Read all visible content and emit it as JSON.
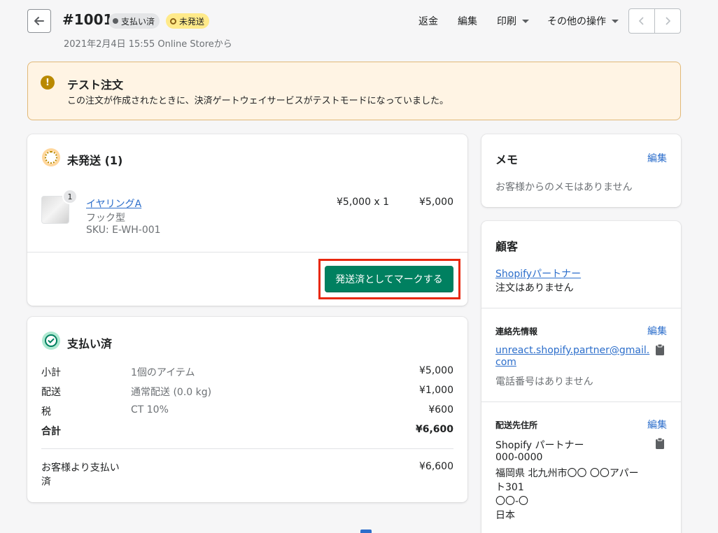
{
  "header": {
    "order_number": "#1001",
    "badge_paid": "支払い済",
    "badge_unfulfilled": "未発送",
    "subline": "2021年2月4日 15:55 Online Storeから",
    "actions": [
      "返金",
      "編集",
      "印刷",
      "その他の操作"
    ]
  },
  "banner": {
    "icon": "exclamation-icon",
    "title": "テスト注文",
    "text": "この注文が作成されたときに、決済ゲートウェイサービスがテストモードになっていました。"
  },
  "unfulfilled": {
    "title": "未発送 (1)",
    "item": {
      "quantity_badge": "1",
      "name": "イヤリングA",
      "variant": "フック型",
      "sku": "SKU: E-WH-001",
      "unit_price": "¥5,000 x 1",
      "total": "¥5,000"
    },
    "button": "発送済としてマークする"
  },
  "payment": {
    "title": "支払い済",
    "rows": [
      {
        "label": "小計",
        "detail": "1個のアイテム",
        "amount": "¥5,000"
      },
      {
        "label": "配送",
        "detail": "通常配送 (0.0 kg)",
        "amount": "¥1,000"
      },
      {
        "label": "税",
        "detail": "CT 10%",
        "amount": "¥600"
      },
      {
        "label": "合計",
        "detail": "",
        "amount": "¥6,600"
      }
    ],
    "paid_label": "お客様より支払い済",
    "paid_amount": "¥6,600"
  },
  "memo": {
    "title": "メモ",
    "edit": "編集",
    "text": "お客様からのメモはありません"
  },
  "customer": {
    "title": "顧客",
    "name": "Shopifyパートナー",
    "orders": "注文はありません",
    "contact_title": "連絡先情報",
    "contact_edit": "編集",
    "email_line1": "unreact.shopify.partner@gmail.",
    "email_line2": "com",
    "phone": "電話番号はありません",
    "address_title": "配送先住所",
    "address_edit": "編集",
    "address_lines": [
      "Shopify パートナー",
      "000-0000",
      "福岡県 北九州市〇〇 〇〇アパー",
      "ト301",
      "〇〇-〇",
      "日本"
    ]
  },
  "colors": {
    "primary": "#008060",
    "link": "#2c6ecb",
    "highlight": "#e8280f",
    "banner_bg": "#fff4e4"
  }
}
